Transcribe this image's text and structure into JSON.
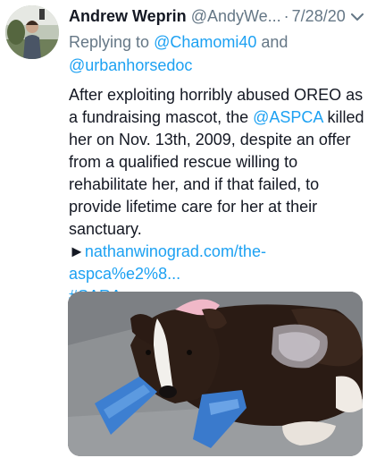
{
  "author": {
    "name": "Andrew Weprin",
    "handle": "@AndyWe...",
    "separator": "·",
    "date": "7/28/20"
  },
  "reply": {
    "prefix": "Replying to",
    "mention_1": "@Chamomi40",
    "conjunction": "and",
    "mention_2": "@urbanhorsedoc"
  },
  "tweet": {
    "text_before": "After exploiting horribly abused OREO as a fundraising mascot, the",
    "mention": "@ASPCA",
    "text_after": "killed her on Nov. 13th, 2009, despite an offer from a qualified rescue willing to rehabilitate her, and if that failed, to provide lifetime care for her at their sanctuary.",
    "link_arrow": "►",
    "link_line1": "nathanwinograd.com/the-",
    "link_line2": "aspca%e2%8...",
    "hashtag": "#SARA"
  },
  "icons": {
    "menu": "chevron-down-icon"
  },
  "colors": {
    "accent": "#1da1f2",
    "secondary_text": "#657786",
    "primary_text": "#141823"
  }
}
